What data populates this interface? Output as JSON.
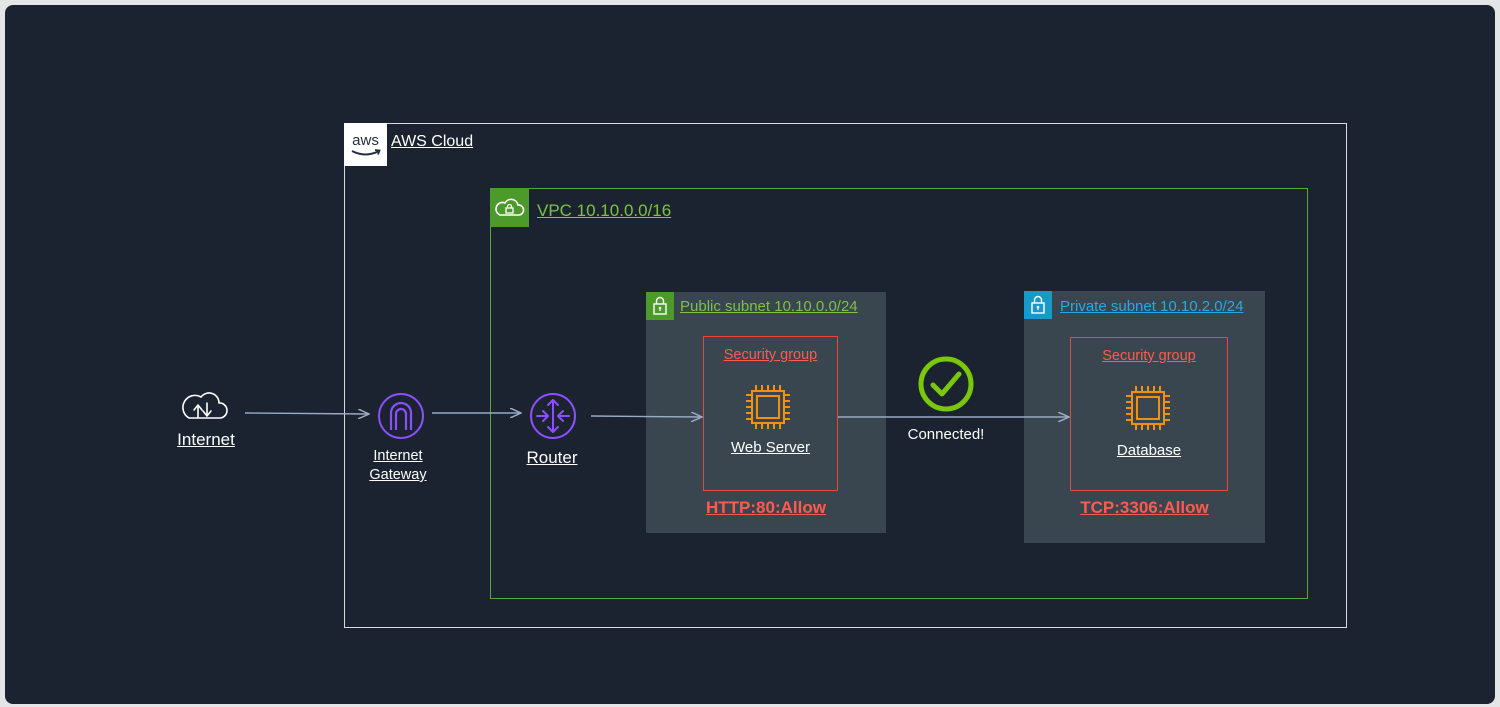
{
  "aws_cloud": {
    "label": "AWS Cloud",
    "logo_text": "aws"
  },
  "vpc": {
    "label": "VPC 10.10.0.0/16"
  },
  "public_subnet": {
    "label": "Public subnet 10.10.0.0/24",
    "security_group": "Security group",
    "server": "Web Server",
    "rule": "HTTP:80:Allow"
  },
  "private_subnet": {
    "label": "Private subnet 10.10.2.0/24",
    "security_group": "Security group",
    "server": "Database",
    "rule": "TCP:3306:Allow"
  },
  "nodes": {
    "internet": "Internet",
    "internet_gateway": "Internet\nGateway",
    "router": "Router"
  },
  "connection": {
    "status": "Connected!"
  },
  "colors": {
    "background": "#1b2330",
    "aws_border": "#d7dbe0",
    "vpc": "#5ca832",
    "public": "#4c9a2a",
    "private": "#1899c7",
    "security_group": "#e8463f",
    "compute": "#f29111",
    "network": "#8c4fff",
    "success": "#7ac70c",
    "flow_line": "#9aaac4"
  }
}
